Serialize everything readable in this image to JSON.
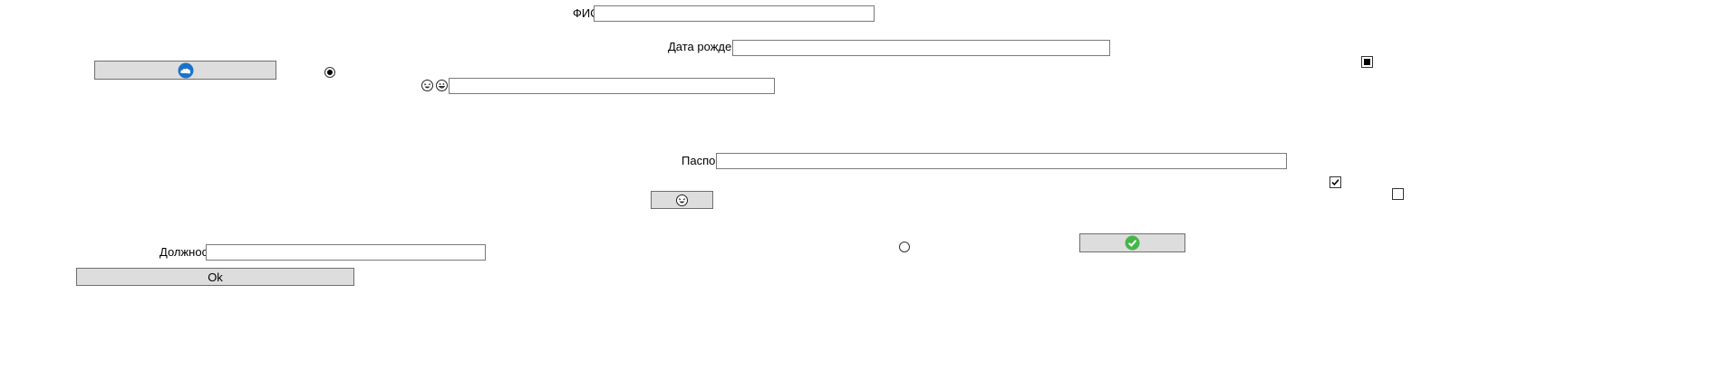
{
  "form": {
    "fio_label": "ФИО",
    "fio_value": "",
    "birthdate_label": "Дата рождения",
    "birthdate_value": "",
    "emoji_field_value": "",
    "passport_label": "Паспорт",
    "passport_value": "",
    "position_label": "Должность",
    "position_value": "",
    "ok_label": "Ok"
  },
  "controls": {
    "radio_top_checked": true,
    "radio_bottom_checked": false,
    "checkbox_top_right_state": "indeterminate",
    "checkbox_middle_checked": true,
    "checkbox_far_right_checked": false
  },
  "icons": {
    "cloud_button_icon": "cloud-icon",
    "laughing_face_icon": "laughing-face-icon",
    "grinning_face_icon": "grinning-face-icon",
    "face_button_icon": "laughing-face-icon",
    "check_button_icon": "checkmark-circle-icon"
  },
  "colors": {
    "button_bg": "#dddddd",
    "cloud_blue": "#1a73c9",
    "check_green": "#45b649"
  }
}
